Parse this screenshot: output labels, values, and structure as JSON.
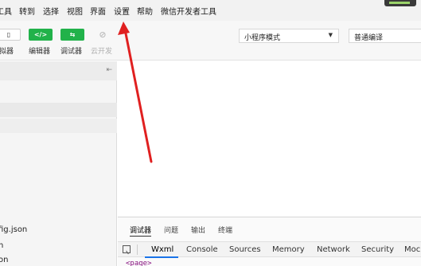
{
  "menu": {
    "items": [
      "工具",
      "转到",
      "选择",
      "视图",
      "界面",
      "设置",
      "帮助",
      "微信开发者工具"
    ]
  },
  "toolbar": {
    "buttons": [
      {
        "glyph": "▯",
        "label": "模拟器"
      },
      {
        "glyph": "</>",
        "label": "编辑器"
      },
      {
        "glyph": "⇆",
        "label": "调试器"
      },
      {
        "glyph": "⊘",
        "label": "云开发"
      }
    ],
    "mode_select": "小程序模式",
    "compile_select": "普通编译"
  },
  "left_panel": {
    "collapse_icon": "⇤",
    "files": [
      "fig.json",
      "n",
      "on"
    ]
  },
  "debugger": {
    "top_tabs": [
      "调试器",
      "问题",
      "输出",
      "终端"
    ],
    "dev_tabs": [
      "Wxml",
      "Console",
      "Sources",
      "Memory",
      "Network",
      "Security",
      "Moc"
    ],
    "code_line": "<page>"
  },
  "annotation": {
    "arrow_color": "#e02020"
  }
}
